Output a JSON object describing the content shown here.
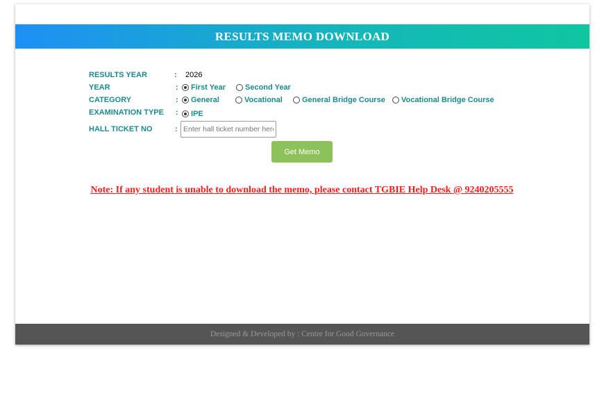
{
  "header": {
    "title": "RESULTS MEMO DOWNLOAD"
  },
  "form": {
    "results_year": {
      "label": "RESULTS YEAR",
      "colon": ":",
      "value": "2026"
    },
    "year": {
      "label": "YEAR",
      "colon": ":",
      "options": [
        {
          "label": "First Year",
          "checked": true
        },
        {
          "label": "Second Year",
          "checked": false
        }
      ]
    },
    "category": {
      "label": "CATEGORY",
      "colon": ":",
      "options": [
        {
          "label": "General",
          "checked": true
        },
        {
          "label": "Vocational",
          "checked": false
        },
        {
          "label": "General Bridge Course",
          "checked": false
        },
        {
          "label": "Vocational Bridge Course",
          "checked": false
        }
      ]
    },
    "exam_type": {
      "label": "EXAMINATION TYPE",
      "colon": ":",
      "options": [
        {
          "label": "IPE",
          "checked": true
        }
      ]
    },
    "hall_ticket": {
      "label": "HALL TICKET NO",
      "colon": ":",
      "placeholder": "Enter hall ticket number here",
      "value": ""
    },
    "submit_label": "Get Memo"
  },
  "note": "Note: If any student is unable to download the memo, please contact TGBIE Help Desk @ 9240205555",
  "footer": {
    "text": "Designed & Developed by : Centre for Good Governance"
  },
  "colors": {
    "header_start": "#1e90f5",
    "header_end": "#0fc6a0",
    "label": "#1a8a8a",
    "button": "#8dc159",
    "note": "#ff1a1a",
    "footer_bg": "#555555"
  }
}
